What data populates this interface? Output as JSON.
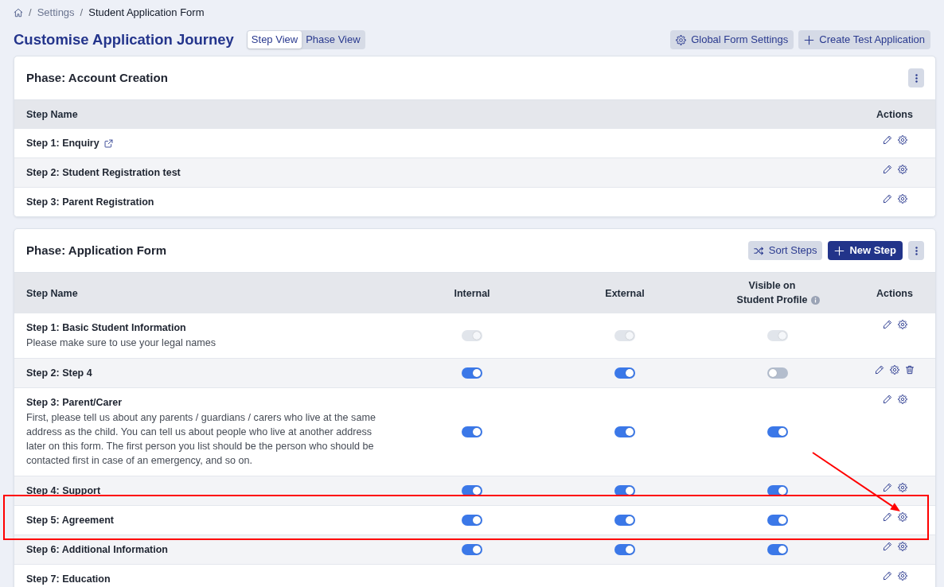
{
  "breadcrumb": [
    {
      "separator": "/",
      "label": "Settings",
      "selected": false
    },
    {
      "separator": "/",
      "label": "Student Application Form",
      "selected": true
    }
  ],
  "header": {
    "title": "Customise Application Journey",
    "views": [
      {
        "label": "Step View",
        "selected": true
      },
      {
        "label": "Phase View",
        "selected": false
      }
    ],
    "actions": [
      {
        "label": "Global Form Settings",
        "kind": "settings",
        "primary": false
      },
      {
        "label": "Create Test Application",
        "kind": "create",
        "primary": false
      }
    ]
  },
  "phases": [
    {
      "title": "Phase: Account Creation",
      "columns": [
        {
          "label": "Step Name",
          "kind": "name",
          "info": false
        },
        {
          "label": "Actions",
          "kind": "actions",
          "info": false
        }
      ],
      "rows": [
        {
          "name": "Step 1: Enquiry",
          "external_link": true,
          "actions": [
            {
              "kind": "edit"
            },
            {
              "kind": "settings"
            }
          ]
        },
        {
          "name": "Step 2: Student Registration test",
          "external_link": false,
          "actions": [
            {
              "kind": "edit"
            },
            {
              "kind": "settings"
            }
          ]
        },
        {
          "name": "Step 3: Parent Registration",
          "external_link": false,
          "actions": [
            {
              "kind": "edit"
            },
            {
              "kind": "settings"
            }
          ]
        }
      ]
    },
    {
      "title": "Phase: Application Form",
      "buttons": [
        {
          "label": "Sort Steps",
          "kind": "sort",
          "primary": false
        },
        {
          "label": "New Step",
          "kind": "create",
          "primary": true
        }
      ],
      "columns": [
        {
          "label": "Step Name",
          "kind": "name",
          "info": false
        },
        {
          "label": "Internal",
          "kind": "toggle",
          "info": false
        },
        {
          "label": "External",
          "kind": "toggle",
          "info": false
        },
        {
          "label": "Visible on Student Profile",
          "kind": "toggle",
          "info": true
        },
        {
          "label": "Actions",
          "kind": "actions",
          "info": false
        }
      ],
      "rows": [
        {
          "name": "Step 1: Basic Student Information",
          "external_link": false,
          "description": "Please make sure to use your legal names",
          "toggles": [
            {
              "on": true,
              "disabled": true
            },
            {
              "on": true,
              "disabled": true
            },
            {
              "on": true,
              "disabled": true
            }
          ],
          "actions": [
            {
              "kind": "edit"
            },
            {
              "kind": "settings"
            }
          ]
        },
        {
          "name": "Step 2: Step 4",
          "external_link": false,
          "toggles": [
            {
              "on": true,
              "disabled": false
            },
            {
              "on": true,
              "disabled": false
            },
            {
              "on": false,
              "disabled": false
            }
          ],
          "actions": [
            {
              "kind": "edit"
            },
            {
              "kind": "settings"
            },
            {
              "kind": "delete"
            }
          ]
        },
        {
          "name": "Step 3: Parent/Carer",
          "external_link": false,
          "description": "First, please tell us about any parents / guardians / carers who live at the same address as the child. You can tell us about people who live at another address later on this form. The first person you list should be the person who should be contacted first in case of an emergency, and so on.",
          "toggles": [
            {
              "on": true,
              "disabled": false
            },
            {
              "on": true,
              "disabled": false
            },
            {
              "on": true,
              "disabled": false
            }
          ],
          "actions": [
            {
              "kind": "edit"
            },
            {
              "kind": "settings"
            }
          ]
        },
        {
          "name": "Step 4: Support",
          "external_link": false,
          "toggles": [
            {
              "on": true,
              "disabled": false
            },
            {
              "on": true,
              "disabled": false
            },
            {
              "on": true,
              "disabled": false
            }
          ],
          "actions": [
            {
              "kind": "edit"
            },
            {
              "kind": "settings"
            }
          ]
        },
        {
          "name": "Step 5: Agreement",
          "external_link": false,
          "toggles": [
            {
              "on": true,
              "disabled": false
            },
            {
              "on": true,
              "disabled": false
            },
            {
              "on": true,
              "disabled": false
            }
          ],
          "actions": [
            {
              "kind": "edit"
            },
            {
              "kind": "settings"
            }
          ]
        },
        {
          "name": "Step 6: Additional Information",
          "external_link": false,
          "toggles": [
            {
              "on": true,
              "disabled": false
            },
            {
              "on": true,
              "disabled": false
            },
            {
              "on": true,
              "disabled": false
            }
          ],
          "actions": [
            {
              "kind": "edit"
            },
            {
              "kind": "settings"
            }
          ]
        },
        {
          "name": "Step 7: Education",
          "external_link": false,
          "actions": [
            {
              "kind": "edit"
            },
            {
              "kind": "settings"
            }
          ]
        }
      ]
    }
  ]
}
